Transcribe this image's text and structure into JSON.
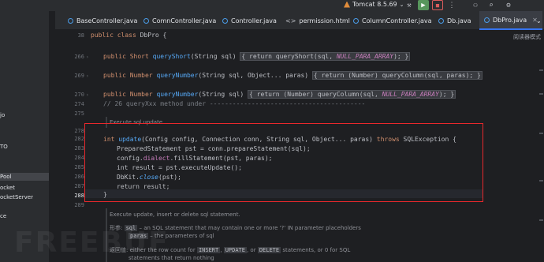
{
  "toolbar": {
    "run_config": "Tomcat 8.5.69",
    "run_glyph": "▶",
    "stop_glyph": "■",
    "icons": [
      "hammer-icon",
      "run-icon",
      "stop-icon",
      "more-icon",
      "add-user-icon",
      "search-icon",
      "settings-icon"
    ]
  },
  "tabs": [
    {
      "label": "BaseController.java"
    },
    {
      "label": "ComnController.java"
    },
    {
      "label": "Controller.java"
    },
    {
      "label": "permission.html"
    },
    {
      "label": "ColumnController.java"
    },
    {
      "label": "Db.java"
    },
    {
      "label": "DbPro.java",
      "active": true
    }
  ],
  "project_tree": {
    "items": [
      "jo",
      "TO",
      "Pool",
      "ocket",
      "ocketServer",
      "ce"
    ]
  },
  "editor": {
    "reader_mode": "阅读器模式",
    "line_numbers": {
      "l38": "38",
      "l266": "266",
      "l269": "269",
      "l270": "270",
      "l274": "274",
      "l275": "275",
      "l278": "278",
      "l282": "282",
      "l283": "283",
      "l284": "284",
      "l285": "285",
      "l286": "286",
      "l287": "287",
      "l288": "288",
      "l289": "289"
    },
    "code": {
      "class_decl_kw": "public class ",
      "class_decl_name": "DbPro {",
      "qs_pre": "public Short ",
      "qs_fn": "queryShort",
      "qs_args": "(String sql) ",
      "qs_body_a": "{ return queryShort(sql, ",
      "qs_body_const": "NULL_PARA_ARRAY",
      "qs_body_b": "); }",
      "qn1_pre": "public Number ",
      "qn1_fn": "queryNumber",
      "qn1_args": "(String sql, Object... paras) ",
      "qn1_body": "{ return (Number) queryColumn(sql, paras); }",
      "qn2_pre": "public Number ",
      "qn2_fn": "queryNumber",
      "qn2_args": "(String sql) ",
      "qn2_body_a": "{ return (Number) queryColumn(sql, ",
      "qn2_body_const": "NULL_PARA_ARRAY",
      "qn2_body_b": "); }",
      "comment": "// 26 queryXxx method under -----------------------------------------",
      "update_pre": "int ",
      "update_fn": "update",
      "update_args": "(Config config, Connection conn, String sql, Object... paras) ",
      "update_throws": "throws ",
      "update_exc": "SQLException {",
      "l283": "PreparedStatement pst = conn.prepareStatement(sql);",
      "l284_a": "config.",
      "l284_field": "dialect",
      "l284_b": ".fillStatement(pst, paras);",
      "l285": "int result = pst.executeUpdate();",
      "l286_a": "DbKit.",
      "l286_fn": "close",
      "l286_b": "(pst);",
      "l287": "return result;",
      "l288": "}"
    },
    "doc1": "Execute sql update",
    "doc2": {
      "line1": "Execute update, insert or delete sql statement.",
      "params_tag": "形参:",
      "p1_code": "sql",
      "p1_text": " – an SQL statement that may contain one or more '?' IN parameter placeholders",
      "p2_code": "paras",
      "p2_text": " – the parameters of sql",
      "returns_tag": "返回值:",
      "r_text_a": "either the row count for ",
      "r_code1": "INSERT",
      "r_sep1": ", ",
      "r_code2": "UPDATE",
      "r_sep2": ", or ",
      "r_code3": "DELETE",
      "r_text_b": " statements, or 0 for SQL",
      "r_text_c": "statements that return nothing"
    }
  },
  "watermark": "FREEBUF",
  "colors": {
    "highlight_box": "#e8282c",
    "accent": "#3574f0"
  }
}
